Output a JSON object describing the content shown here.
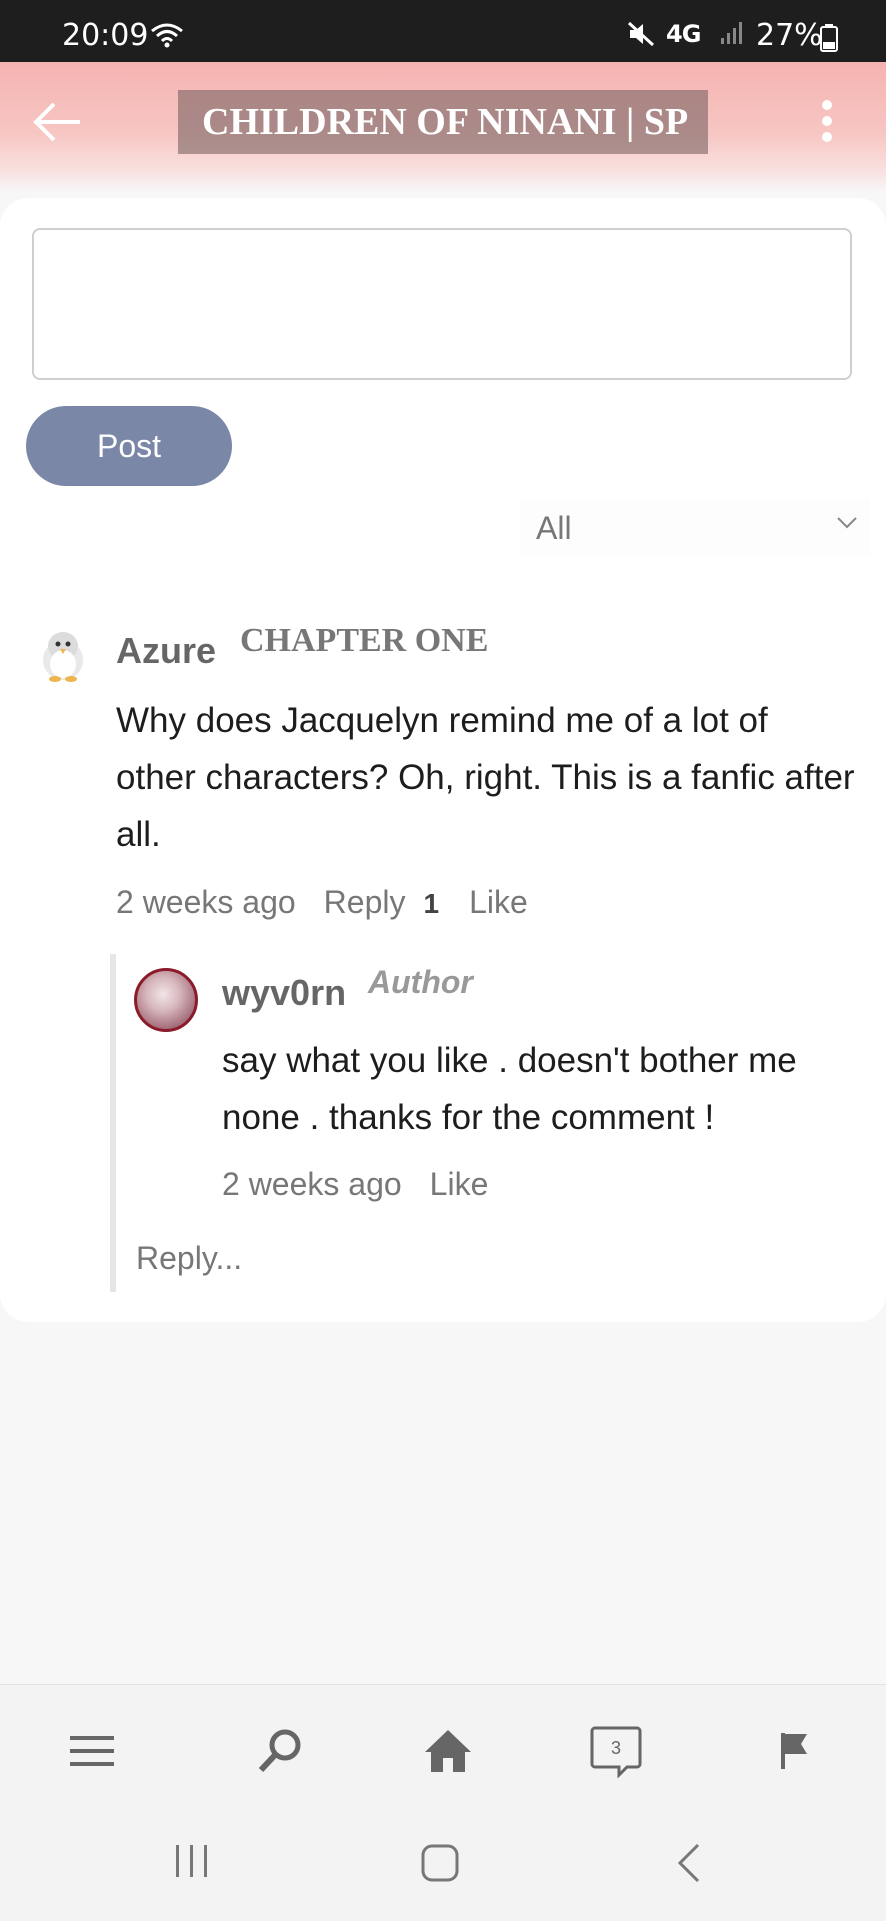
{
  "status_bar": {
    "time": "20:09",
    "network": "4G",
    "battery": "27%"
  },
  "header": {
    "title": "CHILDREN OF NINANI | SP"
  },
  "composer": {
    "input_placeholder": "",
    "post_label": "Post"
  },
  "filter": {
    "selected": "All"
  },
  "comment": {
    "author": "Azure",
    "chapter": "CHAPTER ONE",
    "text": "Why does Jacquelyn remind me of a lot of other characters? Oh, right. This is a fanfic after all.",
    "time": "2 weeks ago",
    "reply_label": "Reply",
    "reply_count": "1",
    "like_label": "Like"
  },
  "reply": {
    "author": "wyv0rn",
    "role": "Author",
    "text": "say what you like . doesn't bother me none . thanks for the comment !",
    "time": "2 weeks ago",
    "like_label": "Like"
  },
  "reply_prompt": "Reply...",
  "bottom_nav": {
    "messages_count": "3",
    "items": [
      "menu-icon",
      "search-icon",
      "home-icon",
      "messages-icon",
      "flag-icon"
    ]
  },
  "colors": {
    "header_pink": "#f5b3b1",
    "post_button": "#7a87a6",
    "author_avatar_border": "#8b1b2a"
  }
}
